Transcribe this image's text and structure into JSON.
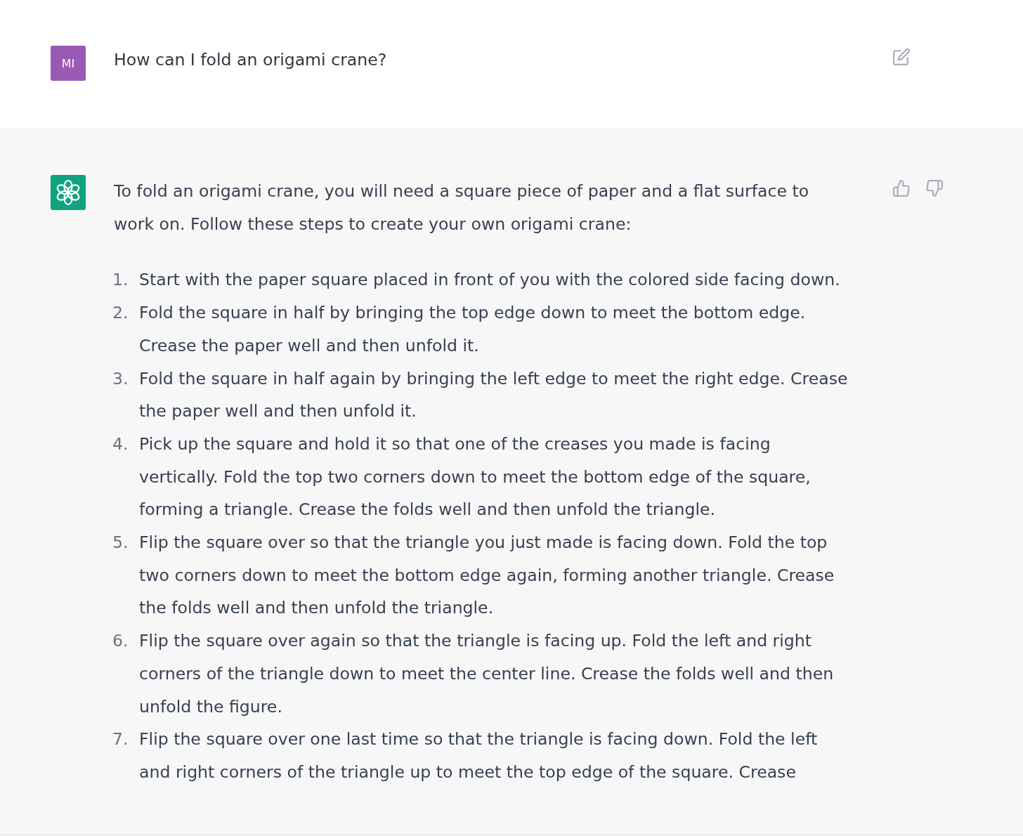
{
  "messages": [
    {
      "kind": "user",
      "initials": "MI",
      "blocks": [
        {
          "kind": "paragraph",
          "text": "How can I fold an origami crane?"
        }
      ],
      "actions": [
        {
          "kind": "edit"
        }
      ]
    },
    {
      "kind": "assistant",
      "blocks": [
        {
          "kind": "paragraph",
          "text": "To fold an origami crane, you will need a square piece of paper and a flat surface to work on. Follow these steps to create your own origami crane:"
        },
        {
          "kind": "list",
          "items": [
            {
              "number": "1.",
              "text": "Start with the paper square placed in front of you with the colored side facing down."
            },
            {
              "number": "2.",
              "text": "Fold the square in half by bringing the top edge down to meet the bottom edge. Crease the paper well and then unfold it."
            },
            {
              "number": "3.",
              "text": "Fold the square in half again by bringing the left edge to meet the right edge. Crease the paper well and then unfold it."
            },
            {
              "number": "4.",
              "text": "Pick up the square and hold it so that one of the creases you made is facing vertically. Fold the top two corners down to meet the bottom edge of the square, forming a triangle. Crease the folds well and then unfold the triangle."
            },
            {
              "number": "5.",
              "text": "Flip the square over so that the triangle you just made is facing down. Fold the top two corners down to meet the bottom edge again, forming another triangle. Crease the folds well and then unfold the triangle."
            },
            {
              "number": "6.",
              "text": "Flip the square over again so that the triangle is facing up. Fold the left and right corners of the triangle down to meet the center line. Crease the folds well and then unfold the figure."
            },
            {
              "number": "7.",
              "text": "Flip the square over one last time so that the triangle is facing down. Fold the left and right corners of the triangle up to meet the top edge of the square. Crease"
            }
          ]
        }
      ],
      "actions": [
        {
          "kind": "thumbs_up"
        },
        {
          "kind": "thumbs_down"
        }
      ]
    }
  ]
}
